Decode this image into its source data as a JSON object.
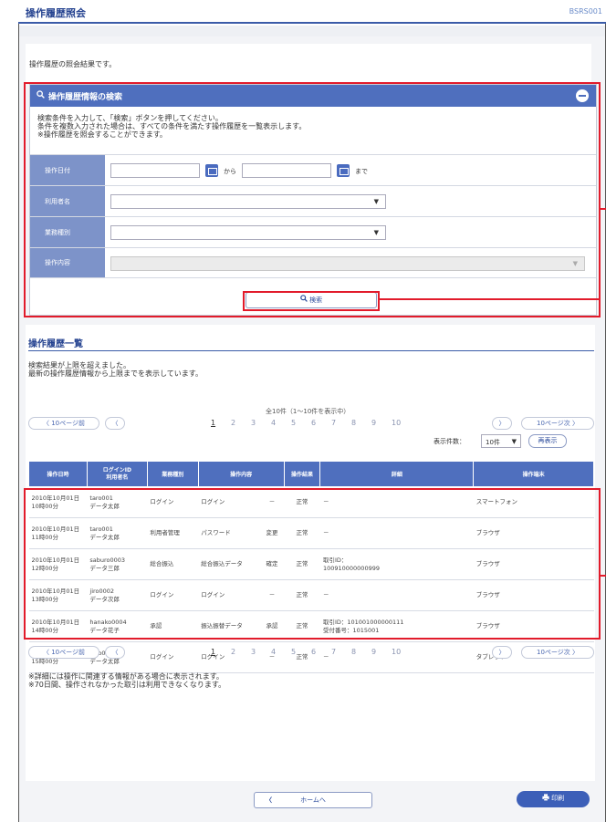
{
  "window": {
    "title": "操作履歴照会",
    "code": "BSRS001"
  },
  "intro": "操作履歴の照会結果です。",
  "search": {
    "header": "操作履歴情報の検索",
    "instructions": [
      "検索条件を入力して、「検索」ボタンを押してください。",
      "条件を複数入力された場合は、すべての条件を満たす操作履歴を一覧表示します。",
      "※操作履歴を照会することができます。"
    ],
    "fields": {
      "date_label": "操作日付",
      "from_text": "から",
      "to_text": "まで",
      "user_label": "利用者名",
      "business_label": "業務種別",
      "content_label": "操作内容"
    },
    "search_button": "検索"
  },
  "list": {
    "heading": "操作履歴一覧",
    "messages": [
      "検索結果が上限を超えました。",
      "最新の操作履歴情報から上限までを表示しています。"
    ],
    "summary": "全10件（1～10件を表示中）",
    "pager": {
      "prev10": "10ページ前",
      "next10": "10ページ次",
      "pages": [
        "1",
        "2",
        "3",
        "4",
        "5",
        "6",
        "7",
        "8",
        "9",
        "10"
      ],
      "active_page": "1"
    },
    "display_count_label": "表示件数：",
    "display_count_value": "10件",
    "redisplay_button": "再表示",
    "columns": [
      "操作日時",
      "ログインID\n利用者名",
      "業務種別",
      "操作内容",
      "操作結果",
      "詳細",
      "操作端末"
    ],
    "rows": [
      {
        "datetime": "2010年10月01日\n10時00分",
        "user": "taro001\nデータ太郎",
        "business": "ログイン",
        "content": "ログイン",
        "sub": "－",
        "result": "正常",
        "detail": "－",
        "terminal": "スマートフォン"
      },
      {
        "datetime": "2010年10月01日\n11時00分",
        "user": "taro001\nデータ太郎",
        "business": "利用者管理",
        "content": "パスワード",
        "sub": "変更",
        "result": "正常",
        "detail": "－",
        "terminal": "ブラウザ"
      },
      {
        "datetime": "2010年10月01日\n12時00分",
        "user": "saburo0003\nデータ三郎",
        "business": "総合振込",
        "content": "総合振込データ",
        "sub": "確定",
        "result": "正常",
        "detail": "取引ID：\n100910000000999",
        "terminal": "ブラウザ"
      },
      {
        "datetime": "2010年10月01日\n13時00分",
        "user": "jiro0002\nデータ次郎",
        "business": "ログイン",
        "content": "ログイン",
        "sub": "－",
        "result": "正常",
        "detail": "－",
        "terminal": "ブラウザ"
      },
      {
        "datetime": "2010年10月01日\n14時00分",
        "user": "hanako0004\nデータ花子",
        "business": "承認",
        "content": "振込振替データ",
        "sub": "承認",
        "result": "正常",
        "detail": "取引ID：101001000000111\n受付番号：1015001",
        "terminal": "ブラウザ"
      },
      {
        "datetime": "2010年10月01日\n15時00分",
        "user": "taro001\nデータ太郎",
        "business": "ログイン",
        "content": "ログイン",
        "sub": "－",
        "result": "正常",
        "detail": "－",
        "terminal": "タブレット"
      }
    ]
  },
  "notes": [
    "※詳細には操作に関連する情報がある場合に表示されます。",
    "※70日間、操作されなかった取引は利用できなくなります。"
  ],
  "footer": {
    "home_button": "ホームへ",
    "print_button": "印刷"
  },
  "colors": {
    "header_blue": "#4f6fbe",
    "label_blue": "#7d93c9",
    "title_blue": "#23418f",
    "highlight_red": "#e21b2b"
  }
}
